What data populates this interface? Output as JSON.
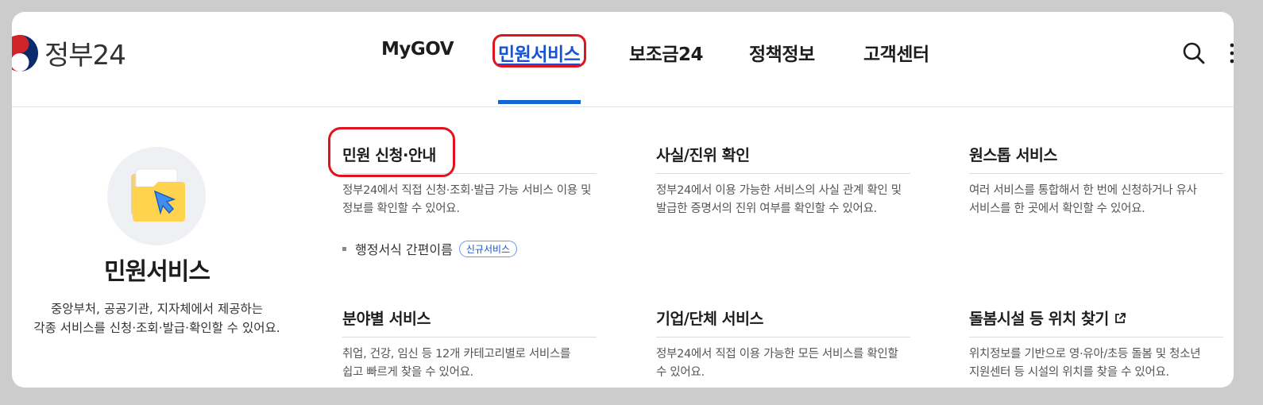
{
  "header": {
    "logo_text": "정부24",
    "nav": [
      "MyGOV",
      "민원서비스",
      "보조금24",
      "정책정보",
      "고객센터"
    ],
    "active_index": 1
  },
  "intro": {
    "title": "민원서비스",
    "desc_line1": "중앙부처, 공공기관, 지자체에서 제공하는",
    "desc_line2": "각종 서비스를 신청·조회·발급·확인할 수 있어요."
  },
  "services": [
    {
      "title": "민원 신청·안내",
      "desc_line1": "정부24에서 직접 신청·조회·발급 가능 서비스 이용 및",
      "desc_line2": "정보를 확인할 수 있어요."
    },
    {
      "title": "사실/진위 확인",
      "desc_line1": "정부24에서 이용 가능한 서비스의 사실 관계 확인 및",
      "desc_line2": "발급한 증명서의 진위 여부를 확인할 수 있어요."
    },
    {
      "title": "원스톱 서비스",
      "desc_line1": "여러 서비스를 통합해서 한 번에 신청하거나 유사",
      "desc_line2": "서비스를 한 곳에서 확인할 수 있어요."
    },
    {
      "title": "분야별 서비스",
      "desc_line1": "취업, 건강, 임신 등 12개 카테고리별로 서비스를",
      "desc_line2": "쉽고 빠르게 찾을 수 있어요."
    },
    {
      "title": "기업/단체 서비스",
      "desc_line1": "정부24에서 직접 이용 가능한 모든 서비스를 확인할",
      "desc_line2": "수 있어요."
    },
    {
      "title": "돌봄시설 등 위치 찾기",
      "desc_line1": "위치정보를 기반으로 영·유아/초등 돌봄 및 청소년",
      "desc_line2": "지원센터 등 시설의 위치를 찾을 수 있어요.",
      "external": true
    }
  ],
  "sub_link": {
    "label": "행정서식 간편이름",
    "badge": "신규서비스"
  },
  "colors": {
    "accent": "#1553d6",
    "active_bar": "#1564d6",
    "annotation": "#e0141f"
  }
}
